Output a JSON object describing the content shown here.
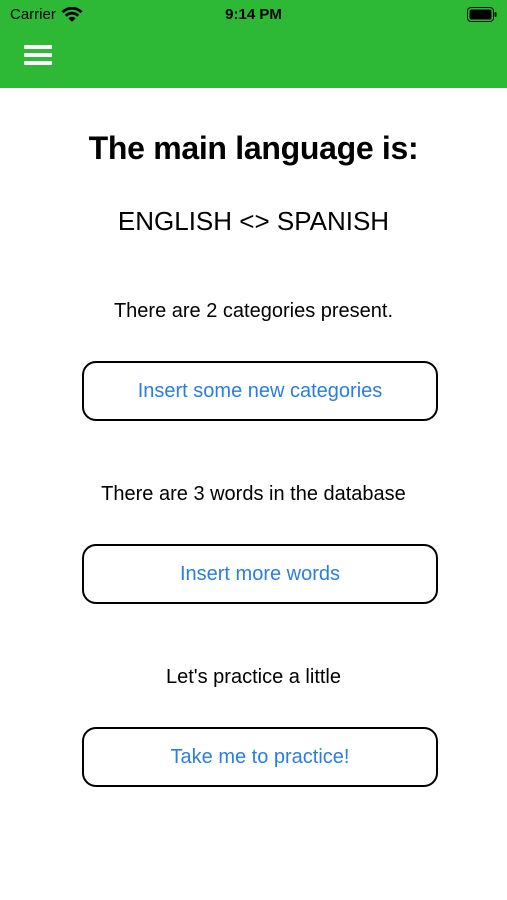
{
  "status_bar": {
    "carrier": "Carrier",
    "time": "9:14 PM",
    "wifi_icon": "wifi-icon",
    "battery_icon": "battery-icon"
  },
  "nav": {
    "menu_icon": "hamburger-menu-icon",
    "background_color": "#2db935"
  },
  "main": {
    "title": "The main language is:",
    "language_pair": "ENGLISH <> SPANISH",
    "categories_text": "There are 2 categories present.",
    "categories_button": "Insert some new categories",
    "words_text": "There are 3 words in the database",
    "words_button": "Insert more words",
    "practice_text": "Let's practice a little",
    "practice_button": "Take me to practice!"
  },
  "colors": {
    "accent": "#2db935",
    "button_text": "#2a7de1",
    "button_border": "#000000"
  }
}
